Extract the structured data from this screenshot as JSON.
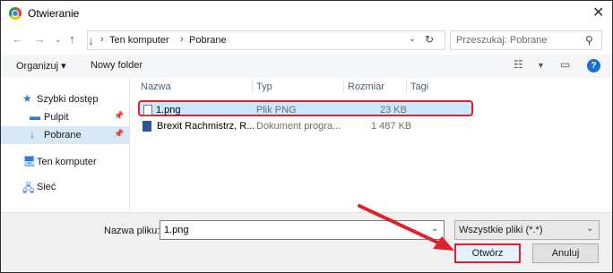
{
  "window": {
    "title": "Otwieranie"
  },
  "address": {
    "crumbs": [
      "Ten komputer",
      "Pobrane"
    ]
  },
  "search": {
    "placeholder": "Przeszukaj: Pobrane"
  },
  "toolbar": {
    "organize": "Organizuj ▾",
    "new_folder": "Nowy folder"
  },
  "sidebar": {
    "quick_access": "Szybki dostęp",
    "desktop": "Pulpit",
    "downloads": "Pobrane",
    "this_pc": "Ten komputer",
    "network": "Sieć"
  },
  "columns": {
    "name": "Nazwa",
    "type": "Typ",
    "size": "Rozmiar",
    "tags": "Tagi"
  },
  "files": [
    {
      "name": "1.png",
      "type": "Plik PNG",
      "size": "23 KB",
      "icon": "image-file-icon",
      "selected": true
    },
    {
      "name": "Brexit Rachmistrz, R...",
      "type": "Dokument progra...",
      "size": "1 487 KB",
      "icon": "word-document-icon",
      "selected": false
    }
  ],
  "bottom": {
    "filename_label": "Nazwa pliku:",
    "filename_value": "1.png",
    "filetype": "Wszystkie pliki (*.*)",
    "open_button": "Otwórz",
    "cancel_button": "Anuluj"
  },
  "colors": {
    "selection_bg": "#cce8ff",
    "highlight_red": "#e0202a",
    "accent_blue": "#1a6fd0"
  }
}
